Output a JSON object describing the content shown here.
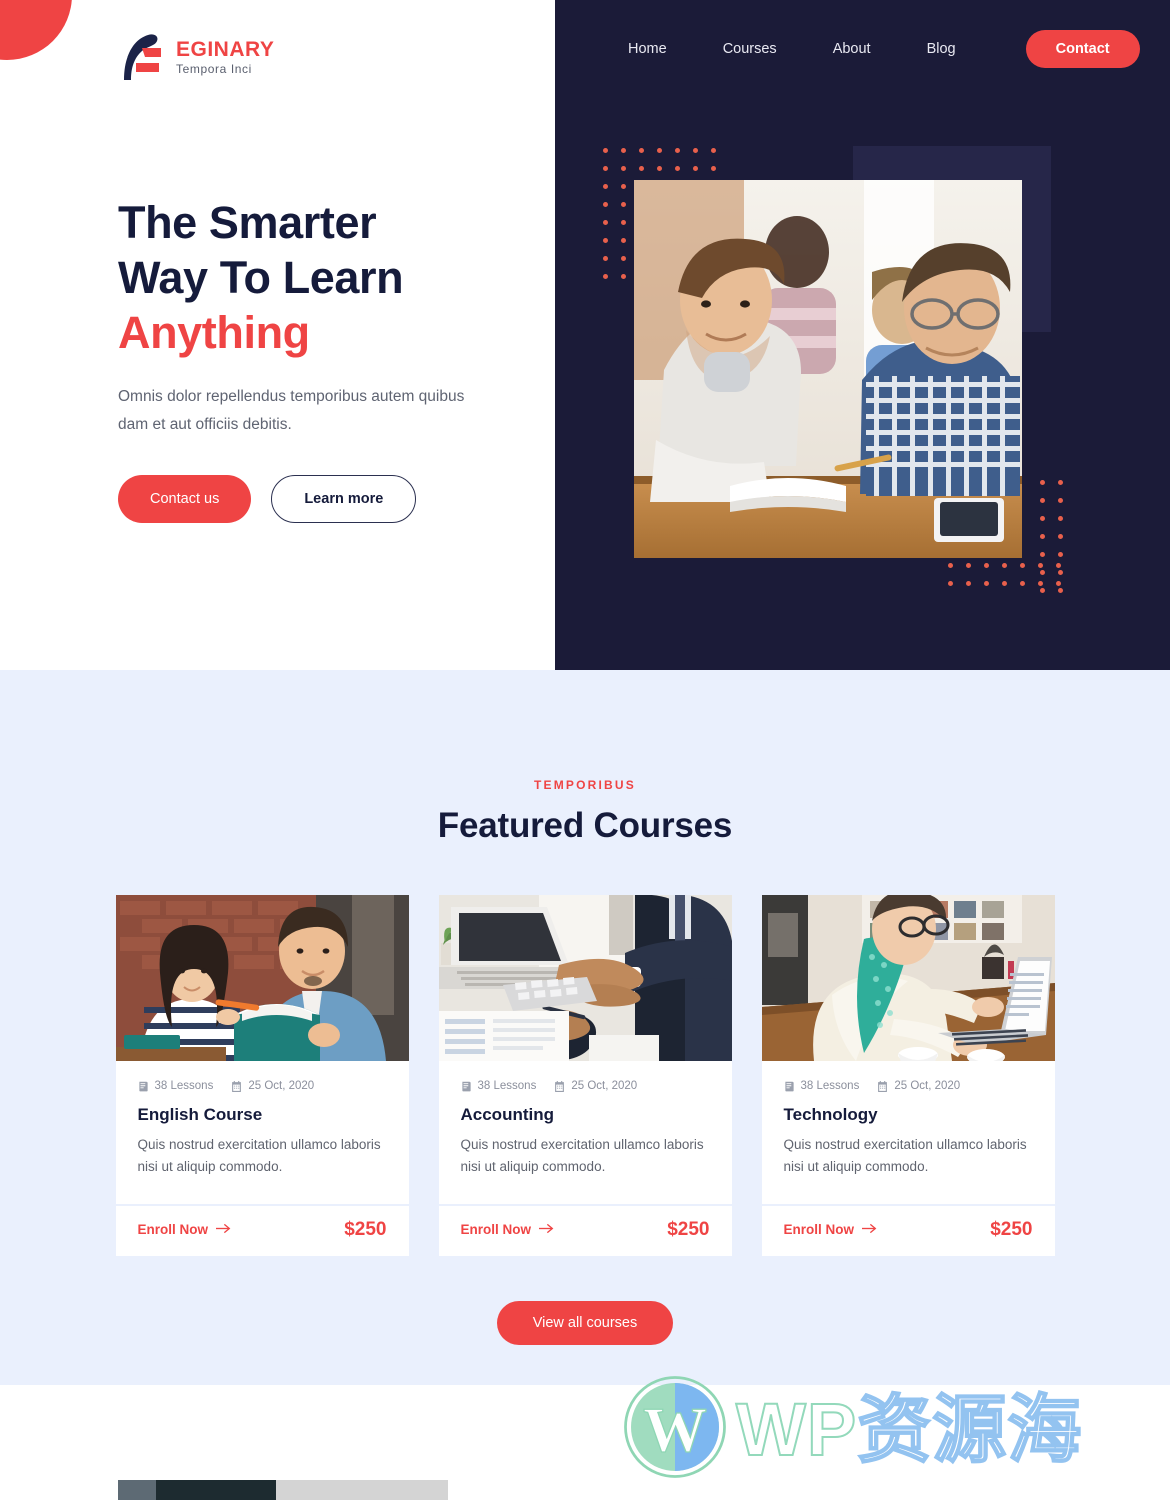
{
  "brand": {
    "name": "EGINARY",
    "tagline": "Tempora Inci",
    "logo_icon": "eginary-logo-mark",
    "accent_color": "#ef4444",
    "dark_color": "#1b1b38"
  },
  "nav": {
    "items": [
      {
        "label": "Home"
      },
      {
        "label": "Courses"
      },
      {
        "label": "About"
      },
      {
        "label": "Blog"
      }
    ],
    "cta_label": "Contact"
  },
  "hero": {
    "title_line1": "The Smarter",
    "title_line2": "Way To Learn",
    "title_accent": "Anything",
    "subtitle": "Omnis dolor repellendus temporibus autem quibus dam et aut officiis debitis.",
    "primary_button": "Contact us",
    "secondary_button": "Learn more",
    "image_alt": "students-studying-photo"
  },
  "courses": {
    "eyebrow": "TEMPORIBUS",
    "title": "Featured Courses",
    "view_all_label": "View all courses",
    "enroll_label": "Enroll Now",
    "items": [
      {
        "lessons": "38 Lessons",
        "date": "25 Oct, 2020",
        "title": "English Course",
        "description": "Quis nostrud exercitation ullamco laboris nisi ut aliquip commodo.",
        "price": "$250",
        "image_alt": "couple-reading-book-photo"
      },
      {
        "lessons": "38 Lessons",
        "date": "25 Oct, 2020",
        "title": "Accounting",
        "description": "Quis nostrud exercitation ullamco laboris nisi ut aliquip commodo.",
        "price": "$250",
        "image_alt": "businessman-calculator-photo"
      },
      {
        "lessons": "38 Lessons",
        "date": "25 Oct, 2020",
        "title": "Technology",
        "description": "Quis nostrud exercitation ullamco laboris nisi ut aliquip commodo.",
        "price": "$250",
        "image_alt": "woman-laptop-photo"
      }
    ]
  },
  "watermark": {
    "latin": "WP",
    "cjk": "资源海",
    "logo_icon": "wordpress-logo-icon"
  }
}
